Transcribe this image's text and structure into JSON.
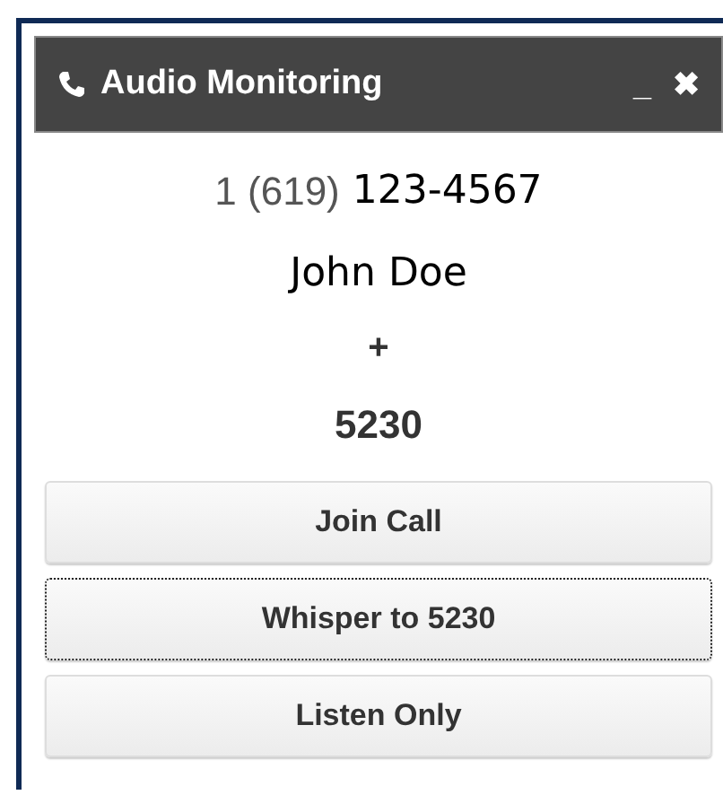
{
  "window": {
    "title": "Audio Monitoring",
    "minimize": "_",
    "close": "✖"
  },
  "caller": {
    "prefix": "1 (619)",
    "number": "123-4567",
    "name": "John Doe"
  },
  "joiner": "+",
  "extension": "5230",
  "buttons": [
    {
      "label": "Join Call",
      "focused": false
    },
    {
      "label": "Whisper to 5230",
      "focused": true
    },
    {
      "label": "Listen Only",
      "focused": false
    }
  ]
}
